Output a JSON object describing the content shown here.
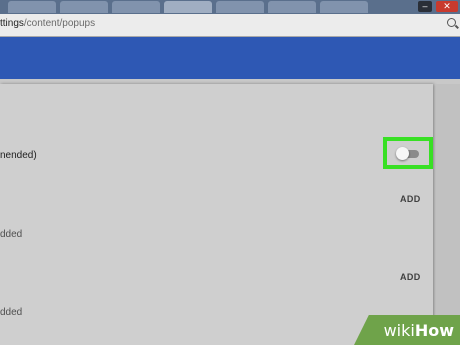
{
  "browser": {
    "url_host_fragment": "ttings",
    "url_path": "/content/popups",
    "window_buttons": {
      "minimize": "–",
      "close": "✕"
    }
  },
  "settings": {
    "popup_toggle_label": "nended)",
    "popup_toggle_on": false,
    "block_section": {
      "add_label": "ADD",
      "empty_text": "dded"
    },
    "allow_section": {
      "add_label": "ADD",
      "empty_text": "dded"
    }
  },
  "watermark": {
    "wiki": "wiki",
    "how": "How"
  },
  "colors": {
    "header_blue": "#2e58b4",
    "highlight_green": "#38e024",
    "watermark_green": "#6fa34a"
  }
}
